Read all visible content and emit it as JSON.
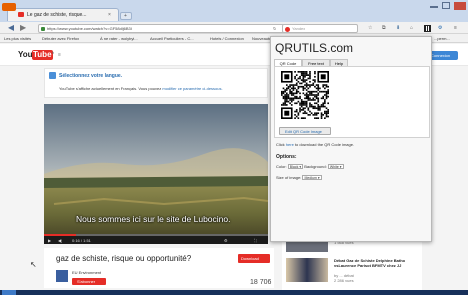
{
  "browser": {
    "tab_title": "Le gaz de schiste, risque...",
    "url": "https://www.youtube.com/watch?v=GF58dlj6B3I",
    "search_placeholder": "Yandex",
    "bookmarks": [
      "Les plus visités",
      "Débuter avec Firefox",
      "À ne rater - wolybyi...",
      "Accueil Particuliers - C...",
      "Hotels / Connexion",
      "Nouveauté"
    ],
    "bookmark_right": "...perm..."
  },
  "youtube": {
    "logo": "You",
    "logo_tube": "Tube",
    "logo_suffix": "fr",
    "signin_label": "Connexion",
    "banner_title": "Sélectionnez votre langue.",
    "banner_text_prefix": "YouTube s'affiche actuellement en Français. Vous pouvez ",
    "banner_link": "modifier ce paramètre ci-dessous.",
    "subtitle": "Nous sommes ici sur le site de Lubocino.",
    "time": "0:16 / 1:51",
    "video_title": "gaz de schiste, risque ou opportunité?",
    "download_label": "Download",
    "channel_name": "EU Environment",
    "subscribe_label": "S'abonner",
    "views": "18 706",
    "sidebar_items": [
      {
        "title": "...",
        "meta": "1 568 vues"
      },
      {
        "title": "Débat Gaz de Schiste Delphine Batho vsLaurence Parisot BFMTV chez JJ",
        "meta": "by ... débat",
        "meta2": "2 286 vues"
      }
    ]
  },
  "qr_popup": {
    "title": "QRUTILS.com",
    "tabs": [
      "QR Code",
      "Free text",
      "Help"
    ],
    "edit_button": "Edit QR Code Image",
    "click_prefix": "Click ",
    "click_link": "here",
    "click_suffix": " to download the QR Code image.",
    "options_label": "Options:",
    "color_label": "Color:",
    "color_value": "Black",
    "background_label": "Background:",
    "background_value": "White",
    "size_label": "Size of image:",
    "size_value": "Medium"
  },
  "colors": {
    "youtube_red": "#e52d27",
    "popup_link": "#2a6db0",
    "taskbar": "#17305a"
  }
}
